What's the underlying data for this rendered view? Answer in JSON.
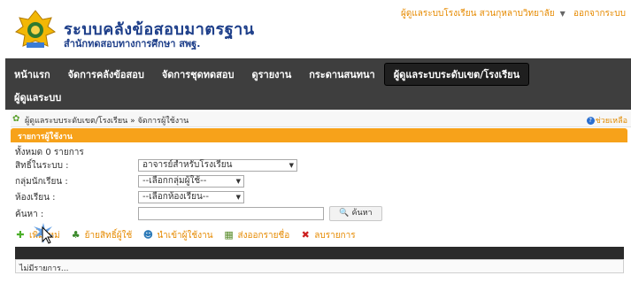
{
  "header": {
    "title": "ระบบคลังข้อสอบมาตรฐาน",
    "subtitle": "สำนักทดสอบทางการศึกษา สพฐ.",
    "user_menu": "ผู้ดูแลระบบโรงเรียน สวนกุหลาบวิทยาลัย",
    "logout": "ออกจากระบบ",
    "logo_icon": "obec-emblem-icon"
  },
  "nav": {
    "items": [
      "หน้าแรก",
      "จัดการคลังข้อสอบ",
      "จัดการชุดทดสอบ",
      "ดูรายงาน",
      "กระดานสนทนา",
      "ผู้ดูแลระบบระดับเขต/โรงเรียน",
      "ผู้ดูแลระบบ"
    ]
  },
  "breadcrumb": {
    "text": "ผู้ดูแลระบบระดับเขต/โรงเรียน » จัดการผู้ใช้งาน",
    "help": "ช่วยเหลือ"
  },
  "panel": {
    "title": "รายการผู้ใช้งาน",
    "count": "ทั้งหมด 0 รายการ"
  },
  "filters": {
    "role_label": "สิทธิ์ในระบบ :",
    "role_value": "อาจารย์สำหรับโรงเรียน",
    "group_label": "กลุ่มนักเรียน :",
    "group_value": "--เลือกกลุ่มผู้ใช้--",
    "room_label": "ห้องเรียน :",
    "room_value": "--เลือกห้องเรียน--",
    "search_label": "ค้นหา :",
    "search_value": "",
    "search_button": "ค้นหา"
  },
  "actions": {
    "add": "เพิ่มใหม่",
    "move_rights": "ย้ายสิทธิ์ผู้ใช้",
    "import": "นำเข้าผู้ใช้งาน",
    "export": "ส่งออกรายชื่อ",
    "delete": "ลบรายการ"
  },
  "grid": {
    "empty": "ไม่มีรายการ..."
  },
  "colors": {
    "accent": "#f7a21a",
    "nav_bg": "#3e3e3e",
    "title": "#1e3f8a",
    "link": "#e68a00"
  }
}
